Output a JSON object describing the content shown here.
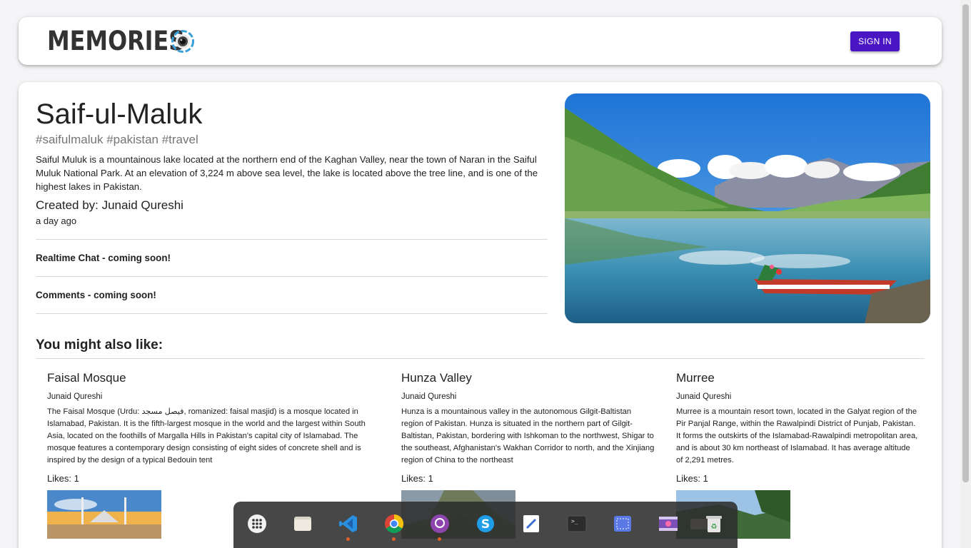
{
  "header": {
    "brand": "MEMORIES",
    "signin_label": "SIGN IN"
  },
  "post": {
    "title": "Saif-ul-Maluk",
    "tags": "#saifulmaluk #pakistan #travel",
    "description": "Saiful Muluk is a mountainous lake located at the northern end of the Kaghan Valley, near the town of Naran in the Saiful Muluk National Park. At an elevation of 3,224 m above sea level, the lake is located above the tree line, and is one of the highest lakes in Pakistan.",
    "created_by": "Created by: Junaid Qureshi",
    "time_ago": "a day ago",
    "chat_notice": "Realtime Chat - coming soon!",
    "comments_notice": "Comments - coming soon!"
  },
  "recommendations": {
    "heading": "You might also like:",
    "items": [
      {
        "title": "Faisal Mosque",
        "author": "Junaid Qureshi",
        "text": "The Faisal Mosque (Urdu: فیصل مسجد, romanized: faisal masjid) is a mosque located in Islamabad, Pakistan. It is the fifth-largest mosque in the world and the largest within South Asia, located on the foothills of Margalla Hills in Pakistan's capital city of Islamabad. The mosque features a contemporary design consisting of eight sides of concrete shell and is inspired by the design of a typical Bedouin tent",
        "likes": "Likes: 1"
      },
      {
        "title": "Hunza Valley",
        "author": "Junaid Qureshi",
        "text": "Hunza is a mountainous valley in the autonomous Gilgit-Baltistan region of Pakistan. Hunza is situated in the northern part of Gilgit-Baltistan, Pakistan, bordering with Ishkoman to the northwest, Shigar to the southeast, Afghanistan's Wakhan Corridor to north, and the Xinjiang region of China to the northeast",
        "likes": "Likes: 1"
      },
      {
        "title": "Murree",
        "author": "Junaid Qureshi",
        "text": "Murree is a mountain resort town, located in the Galyat region of the Pir Panjal Range, within the Rawalpindi District of Punjab, Pakistan. It forms the outskirts of the Islamabad-Rawalpindi metropolitan area, and is about 30 km northeast of Islamabad. It has average altitude of 2,291 metres.",
        "likes": "Likes: 1"
      }
    ]
  },
  "dock": {
    "items": [
      "apps-grid-icon",
      "files-icon",
      "vscode-icon",
      "chrome-icon",
      "github-desktop-icon",
      "skype-icon",
      "text-editor-icon",
      "terminal-icon",
      "screenshot-icon",
      "video-icon",
      "trash-icon"
    ]
  },
  "colors": {
    "accent": "#4a16c4",
    "background": "#f5f5f7"
  }
}
